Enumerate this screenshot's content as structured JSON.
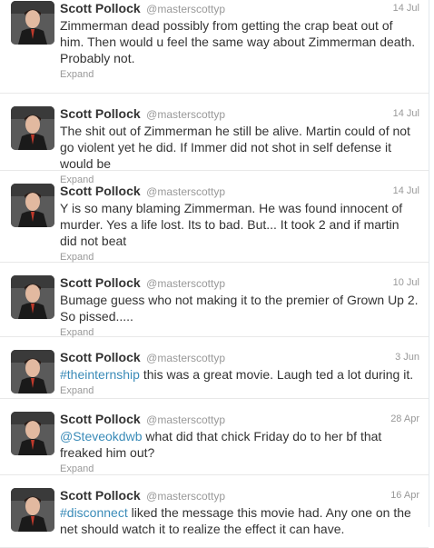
{
  "tweets": [
    {
      "fullname": "Scott Pollock",
      "username": "@masterscottyp",
      "time": "14 Jul",
      "tag": "",
      "text": "Zimmerman dead possibly from getting the crap beat out of him. Then would u feel the same way about Zimmerman death. Probably not.",
      "expand": "Expand"
    },
    {
      "fullname": "Scott Pollock",
      "username": "@masterscottyp",
      "time": "14 Jul",
      "tag": "",
      "text": "The shit out of Zimmerman he still be alive. Martin could of not go violent yet he did. If Immer did not shot in self defense it would be",
      "expand": "Expand"
    },
    {
      "fullname": "Scott Pollock",
      "username": "@masterscottyp",
      "time": "14 Jul",
      "tag": "",
      "text": "Y is so many blaming Zimmerman. He was found innocent of murder. Yes a life lost. Its to bad. But... It took 2 and if martin did not beat",
      "expand": "Expand"
    },
    {
      "fullname": "Scott Pollock",
      "username": "@masterscottyp",
      "time": "10 Jul",
      "tag": "",
      "text": "Bumage guess who not making it to the premier of Grown Up 2. So pissed.....",
      "expand": "Expand"
    },
    {
      "fullname": "Scott Pollock",
      "username": "@masterscottyp",
      "time": "3 Jun",
      "tag": "#theinternship",
      "text": " this was a great movie. Laugh ted a lot during it.",
      "expand": "Expand"
    },
    {
      "fullname": "Scott Pollock",
      "username": "@masterscottyp",
      "time": "28 Apr",
      "tag": "@Steveokdwb",
      "text": " what did that chick Friday do to her bf that freaked him out?",
      "expand": "Expand"
    },
    {
      "fullname": "Scott Pollock",
      "username": "@masterscottyp",
      "time": "16 Apr",
      "tag": "#disconnect",
      "text": "  liked the message this movie had. Any one on the net should watch it to realize the effect it can have.",
      "expand": ""
    }
  ]
}
